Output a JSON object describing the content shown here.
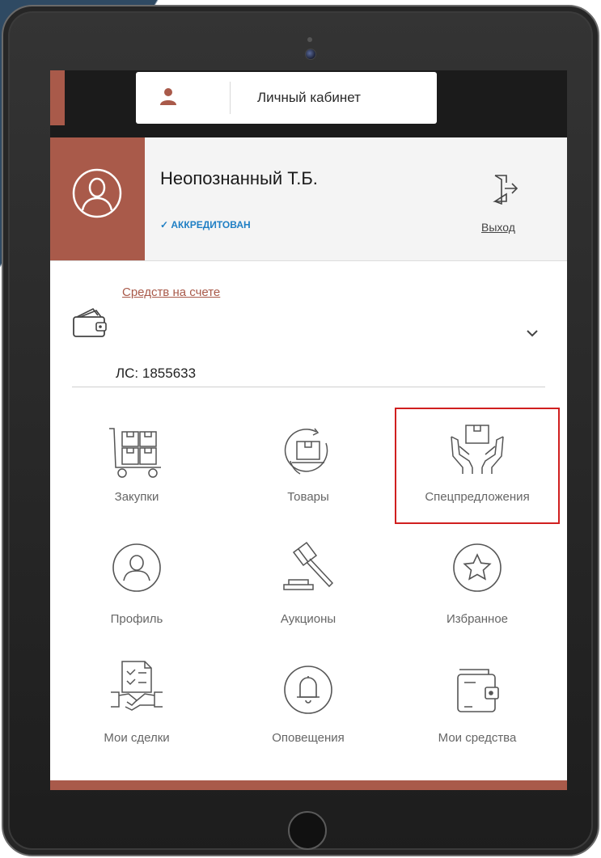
{
  "header": {
    "cabinet_label": "Личный кабинет"
  },
  "profile": {
    "name": "Неопознанный Т.Б.",
    "status": "✓ АККРЕДИТОВАН",
    "logout_label": "Выход"
  },
  "account": {
    "funds_label": "Средств на счете",
    "account_number": "ЛС: 1855633"
  },
  "menu": {
    "items": [
      {
        "label": "Закупки",
        "icon": "cart-icon"
      },
      {
        "label": "Товары",
        "icon": "goods-icon"
      },
      {
        "label": "Спецпредложения",
        "icon": "special-offers-icon"
      },
      {
        "label": "Профиль",
        "icon": "profile-icon"
      },
      {
        "label": "Аукционы",
        "icon": "auction-icon"
      },
      {
        "label": "Избранное",
        "icon": "star-icon"
      },
      {
        "label": "Мои сделки",
        "icon": "deals-icon"
      },
      {
        "label": "Оповещения",
        "icon": "bell-icon"
      },
      {
        "label": "Мои средства",
        "icon": "wallet-icon"
      }
    ]
  },
  "colors": {
    "accent": "#a95a4a",
    "accredited": "#1f7fc4",
    "highlight": "#d01f1f"
  }
}
